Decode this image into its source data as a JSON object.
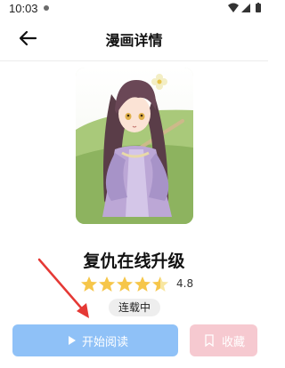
{
  "status_bar": {
    "time": "10:03",
    "icons": [
      "wifi-icon",
      "signal-icon",
      "battery-icon"
    ]
  },
  "header": {
    "title": "漫画详情",
    "back_icon": "arrow-left-icon"
  },
  "comic": {
    "cover_alt": "漫画封面",
    "title": "复仇在线升级",
    "rating": 4.8,
    "rating_text": "4.8",
    "rating_max": 5,
    "status": "连载中"
  },
  "actions": {
    "read_label": "开始阅读",
    "read_icon": "play-icon",
    "favorite_label": "收藏",
    "favorite_icon": "bookmark-icon"
  },
  "colors": {
    "read_button": "#8fc1f7",
    "favorite_button": "#f6c9d0",
    "star": "#f6c64a",
    "annotation_arrow": "#e53935"
  }
}
